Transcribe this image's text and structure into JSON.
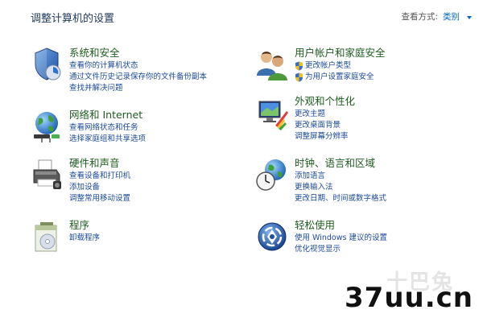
{
  "header": {
    "title": "调整计算机的设置",
    "view_by_label": "查看方式:",
    "view_by_value": "类别"
  },
  "categories": [
    {
      "title": "系统和安全",
      "icon": "shield-icon",
      "links": [
        "查看你的计算机状态",
        "通过文件历史记录保存你的文件备份副本",
        "查找并解决问题"
      ]
    },
    {
      "title": "网络和 Internet",
      "icon": "network-icon",
      "links": [
        "查看网络状态和任务",
        "选择家庭组和共享选项"
      ]
    },
    {
      "title": "硬件和声音",
      "icon": "printer-icon",
      "links": [
        "查看设备和打印机",
        "添加设备",
        "调整常用移动设置"
      ]
    },
    {
      "title": "程序",
      "icon": "programs-icon",
      "links": [
        "卸载程序"
      ]
    },
    {
      "title": "用户帐户和家庭安全",
      "icon": "users-icon",
      "links": [
        "更改帐户类型",
        "为用户设置家庭安全"
      ]
    },
    {
      "title": "外观和个性化",
      "icon": "appearance-icon",
      "links": [
        "更改主题",
        "更改桌面背景",
        "调整屏幕分辨率"
      ]
    },
    {
      "title": "时钟、语言和区域",
      "icon": "clock-globe-icon",
      "links": [
        "添加语言",
        "更换输入法",
        "更改日期、时间或数字格式"
      ]
    },
    {
      "title": "轻松使用",
      "icon": "ease-of-access-icon",
      "links": [
        "使用 Windows 建议的设置",
        "优化视觉显示"
      ]
    }
  ],
  "watermark": {
    "brand": "37uu.cn",
    "faint": "十巴兔"
  }
}
